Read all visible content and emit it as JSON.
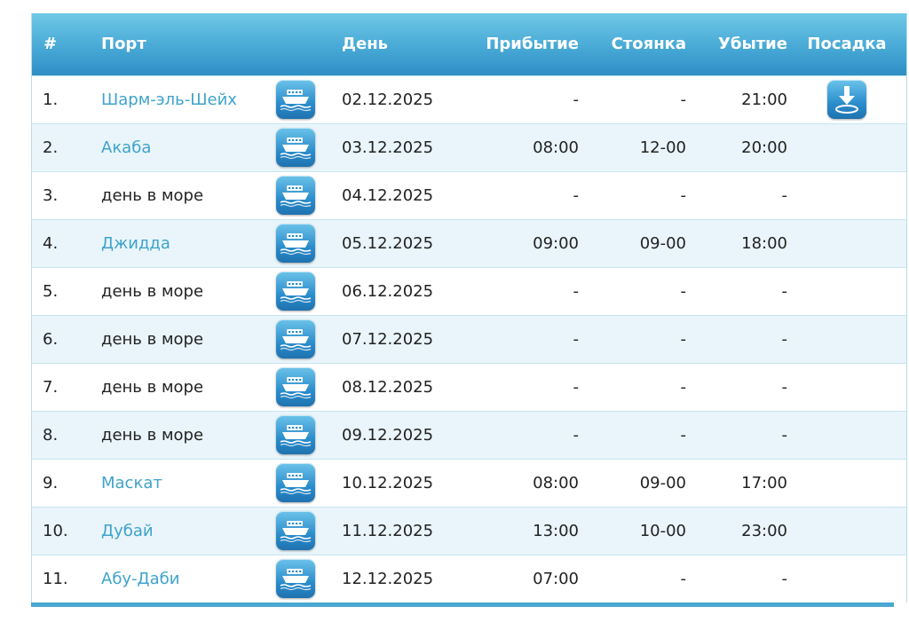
{
  "colors": {
    "header_top": "#6fc8e6",
    "header_bottom": "#2f8fc6",
    "link": "#3fa3cc",
    "row_alt": "#e9f5fa",
    "text": "#222222"
  },
  "columns": {
    "num": "#",
    "port": "Порт",
    "day": "День",
    "arrival": "Прибытие",
    "stay": "Стоянка",
    "departure": "Убытие",
    "boarding": "Посадка"
  },
  "icons": {
    "row_icon": "ship-icon",
    "boarding_icon": "boarding-download-icon"
  },
  "rows": [
    {
      "num": "1.",
      "port": "Шарм-эль-Шейх",
      "link": true,
      "day": "02.12.2025",
      "arrival": "-",
      "stay": "-",
      "departure": "21:00",
      "boarding": true
    },
    {
      "num": "2.",
      "port": "Акаба",
      "link": true,
      "day": "03.12.2025",
      "arrival": "08:00",
      "stay": "12-00",
      "departure": "20:00",
      "boarding": false
    },
    {
      "num": "3.",
      "port": "день в море",
      "link": false,
      "day": "04.12.2025",
      "arrival": "-",
      "stay": "-",
      "departure": "-",
      "boarding": false
    },
    {
      "num": "4.",
      "port": "Джидда",
      "link": true,
      "day": "05.12.2025",
      "arrival": "09:00",
      "stay": "09-00",
      "departure": "18:00",
      "boarding": false
    },
    {
      "num": "5.",
      "port": "день в море",
      "link": false,
      "day": "06.12.2025",
      "arrival": "-",
      "stay": "-",
      "departure": "-",
      "boarding": false
    },
    {
      "num": "6.",
      "port": "день в море",
      "link": false,
      "day": "07.12.2025",
      "arrival": "-",
      "stay": "-",
      "departure": "-",
      "boarding": false
    },
    {
      "num": "7.",
      "port": "день в море",
      "link": false,
      "day": "08.12.2025",
      "arrival": "-",
      "stay": "-",
      "departure": "-",
      "boarding": false
    },
    {
      "num": "8.",
      "port": "день в море",
      "link": false,
      "day": "09.12.2025",
      "arrival": "-",
      "stay": "-",
      "departure": "-",
      "boarding": false
    },
    {
      "num": "9.",
      "port": "Маскат",
      "link": true,
      "day": "10.12.2025",
      "arrival": "08:00",
      "stay": "09-00",
      "departure": "17:00",
      "boarding": false
    },
    {
      "num": "10.",
      "port": "Дубай",
      "link": true,
      "day": "11.12.2025",
      "arrival": "13:00",
      "stay": "10-00",
      "departure": "23:00",
      "boarding": false
    },
    {
      "num": "11.",
      "port": "Абу-Даби",
      "link": true,
      "day": "12.12.2025",
      "arrival": "07:00",
      "stay": "-",
      "departure": "-",
      "boarding": false
    }
  ]
}
